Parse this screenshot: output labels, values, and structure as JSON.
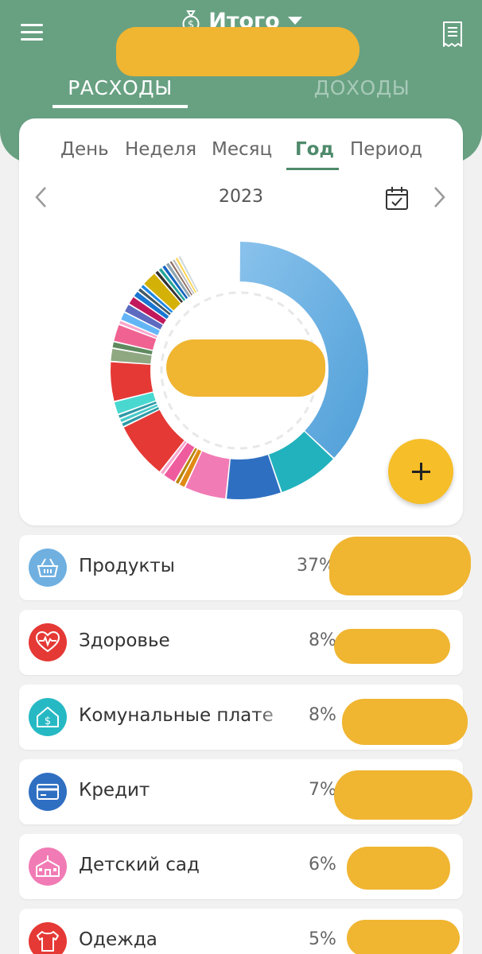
{
  "header": {
    "title": "Итого",
    "tabs": [
      {
        "label": "РАСХОДЫ",
        "active": true
      },
      {
        "label": "ДОХОДЫ",
        "active": false
      }
    ]
  },
  "period_tabs": [
    {
      "label": "День",
      "active": false
    },
    {
      "label": "Неделя",
      "active": false
    },
    {
      "label": "Месяц",
      "active": false
    },
    {
      "label": "Год",
      "active": true
    },
    {
      "label": "Период",
      "active": false
    }
  ],
  "year": "2023",
  "categories": [
    {
      "name": "Продукты",
      "percent": "37%",
      "icon": "basket-icon",
      "color": "#6fb0e0"
    },
    {
      "name": "Здоровье",
      "percent": "8%",
      "icon": "heart-pulse-icon",
      "color": "#e53935"
    },
    {
      "name": "Комунальные плате",
      "percent": "8%",
      "icon": "house-dollar-icon",
      "color": "#26b9c4"
    },
    {
      "name": "Кредит",
      "percent": "7%",
      "icon": "credit-card-icon",
      "color": "#2f6fc2"
    },
    {
      "name": "Детский сад",
      "percent": "6%",
      "icon": "school-icon",
      "color": "#f17bb5"
    },
    {
      "name": "Одежда",
      "percent": "5%",
      "icon": "tshirt-icon",
      "color": "#e53935"
    }
  ],
  "colors": {
    "header_green": "#68a182",
    "accent_green": "#4e8a6b",
    "fab_yellow": "#f6be28",
    "redaction": "#f0b531"
  }
}
